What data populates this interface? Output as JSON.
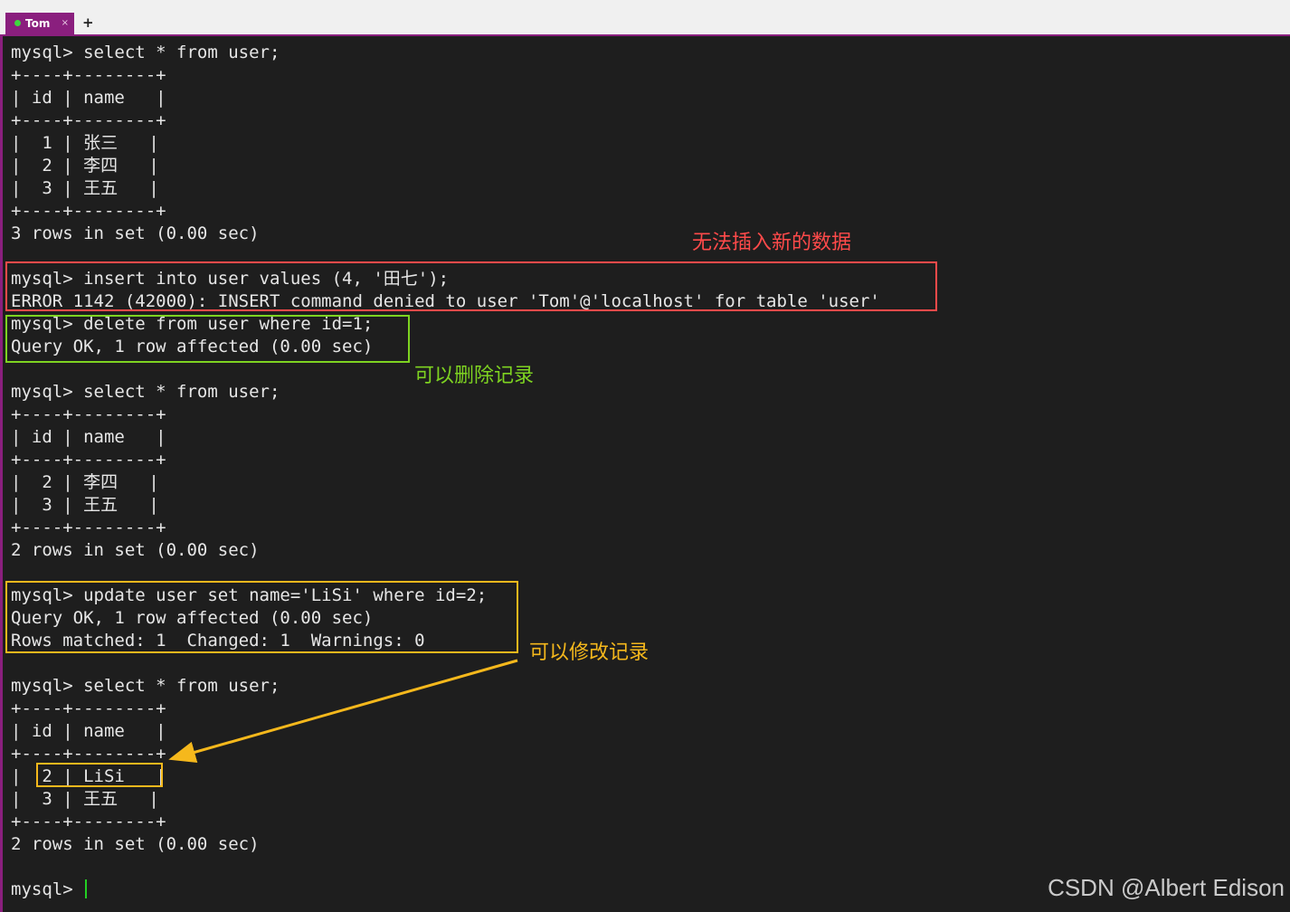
{
  "tab": {
    "title": "Tom",
    "close": "×",
    "add": "+"
  },
  "lines": [
    "mysql> select * from user;",
    "+----+--------+",
    "| id | name   |",
    "+----+--------+",
    "|  1 | 张三   |",
    "|  2 | 李四   |",
    "|  3 | 王五   |",
    "+----+--------+",
    "3 rows in set (0.00 sec)",
    "",
    "mysql> insert into user values (4, '田七');",
    "ERROR 1142 (42000): INSERT command denied to user 'Tom'@'localhost' for table 'user'",
    "mysql> delete from user where id=1;",
    "Query OK, 1 row affected (0.00 sec)",
    "",
    "mysql> select * from user;",
    "+----+--------+",
    "| id | name   |",
    "+----+--------+",
    "|  2 | 李四   |",
    "|  3 | 王五   |",
    "+----+--------+",
    "2 rows in set (0.00 sec)",
    "",
    "mysql> update user set name='LiSi' where id=2;",
    "Query OK, 1 row affected (0.00 sec)",
    "Rows matched: 1  Changed: 1  Warnings: 0",
    "",
    "mysql> select * from user;",
    "+----+--------+",
    "| id | name   |",
    "+----+--------+",
    "|  2 | LiSi   |",
    "|  3 | 王五   |",
    "+----+--------+",
    "2 rows in set (0.00 sec)",
    "",
    "mysql> "
  ],
  "annotations": {
    "insert_denied": "无法插入新的数据",
    "delete_allowed": "可以删除记录",
    "update_allowed": "可以修改记录"
  },
  "colors": {
    "terminal_bg": "#1e1e1e",
    "text": "#e6e6e6",
    "tab_accent": "#8a1f7e",
    "red": "#ff4a4a",
    "green": "#7ed321",
    "orange": "#f5b81c",
    "cursor": "#23d023"
  },
  "watermark": "CSDN @Albert Edison"
}
